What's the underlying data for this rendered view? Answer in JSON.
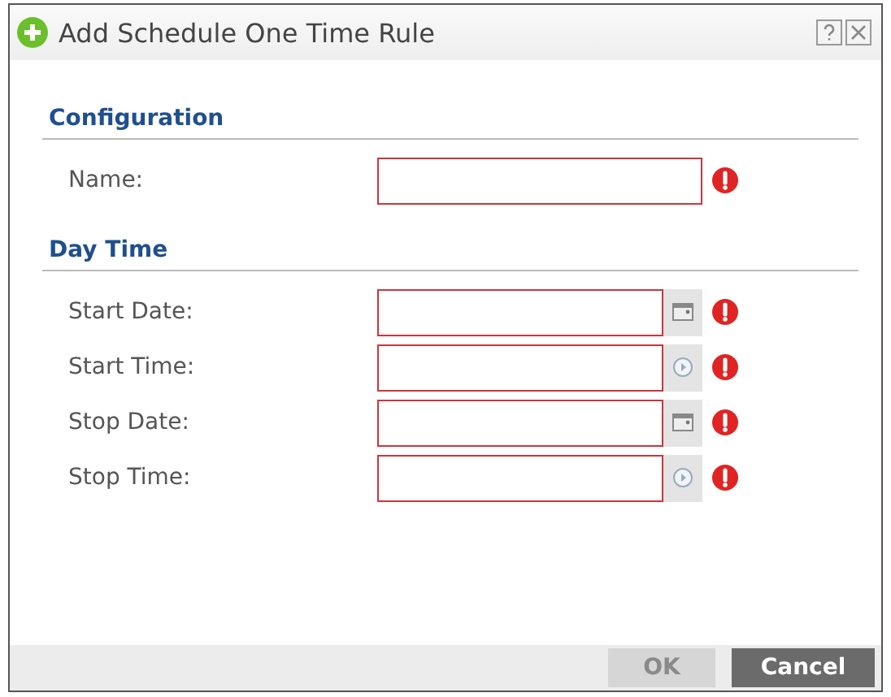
{
  "window": {
    "title": "Add Schedule One Time Rule"
  },
  "sections": [
    {
      "title": "Configuration",
      "fields": [
        {
          "label": "Name:",
          "kind": "text",
          "required": true
        }
      ]
    },
    {
      "title": "Day Time",
      "fields": [
        {
          "label": "Start Date:",
          "kind": "date",
          "required": true
        },
        {
          "label": "Start Time:",
          "kind": "time",
          "required": true
        },
        {
          "label": "Stop Date:",
          "kind": "date",
          "required": true
        },
        {
          "label": "Stop Time:",
          "kind": "time",
          "required": true
        }
      ]
    }
  ],
  "buttons": [
    {
      "label": "OK",
      "disabled": true
    },
    {
      "label": "Cancel",
      "disabled": false
    }
  ]
}
